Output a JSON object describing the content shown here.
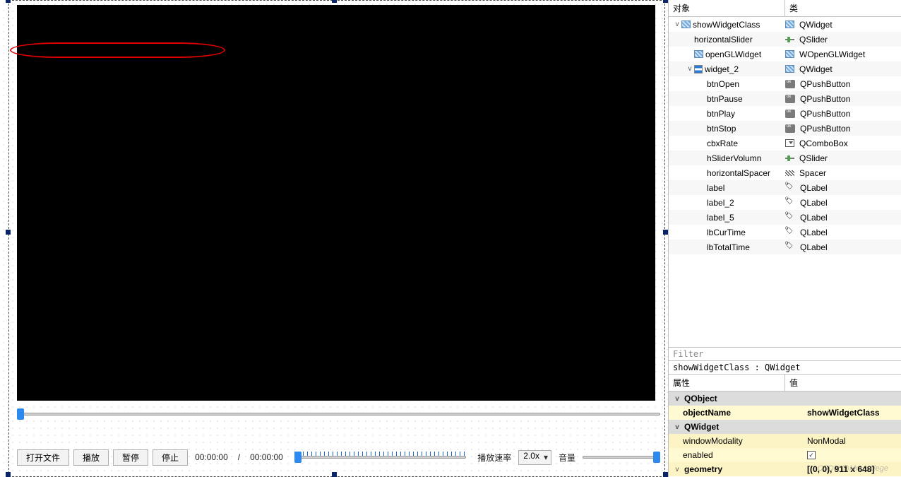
{
  "buttons": {
    "open": "打开文件",
    "play": "播放",
    "pause": "暂停",
    "stop": "停止"
  },
  "time": {
    "cur": "00:00:00",
    "sep": "/",
    "total": "00:00:00"
  },
  "labels": {
    "rate": "播放速率",
    "volume": "音量"
  },
  "combo": {
    "rate_value": "2.0x"
  },
  "inspector": {
    "col_object": "对象",
    "col_class": "类",
    "rows": [
      {
        "depth": 0,
        "expand": "v",
        "obj": "showWidgetClass",
        "icon": "widget",
        "cls": "QWidget",
        "cicon": "widget"
      },
      {
        "depth": 1,
        "expand": "",
        "obj": "horizontalSlider",
        "icon": "",
        "cls": "QSlider",
        "cicon": "slider"
      },
      {
        "depth": 1,
        "expand": "",
        "obj": "openGLWidget",
        "icon": "widget",
        "cls": "WOpenGLWidget",
        "cicon": "widget"
      },
      {
        "depth": 1,
        "expand": "v",
        "obj": "widget_2",
        "icon": "vbox",
        "cls": "QWidget",
        "cicon": "widget"
      },
      {
        "depth": 2,
        "expand": "",
        "obj": "btnOpen",
        "icon": "",
        "cls": "QPushButton",
        "cicon": "btn"
      },
      {
        "depth": 2,
        "expand": "",
        "obj": "btnPause",
        "icon": "",
        "cls": "QPushButton",
        "cicon": "btn"
      },
      {
        "depth": 2,
        "expand": "",
        "obj": "btnPlay",
        "icon": "",
        "cls": "QPushButton",
        "cicon": "btn"
      },
      {
        "depth": 2,
        "expand": "",
        "obj": "btnStop",
        "icon": "",
        "cls": "QPushButton",
        "cicon": "btn"
      },
      {
        "depth": 2,
        "expand": "",
        "obj": "cbxRate",
        "icon": "",
        "cls": "QComboBox",
        "cicon": "combo"
      },
      {
        "depth": 2,
        "expand": "",
        "obj": "hSliderVolumn",
        "icon": "",
        "cls": "QSlider",
        "cicon": "slider"
      },
      {
        "depth": 2,
        "expand": "",
        "obj": "horizontalSpacer",
        "icon": "",
        "cls": "Spacer",
        "cicon": "spacer"
      },
      {
        "depth": 2,
        "expand": "",
        "obj": "label",
        "icon": "",
        "cls": "QLabel",
        "cicon": "label"
      },
      {
        "depth": 2,
        "expand": "",
        "obj": "label_2",
        "icon": "",
        "cls": "QLabel",
        "cicon": "label"
      },
      {
        "depth": 2,
        "expand": "",
        "obj": "label_5",
        "icon": "",
        "cls": "QLabel",
        "cicon": "label"
      },
      {
        "depth": 2,
        "expand": "",
        "obj": "lbCurTime",
        "icon": "",
        "cls": "QLabel",
        "cicon": "label"
      },
      {
        "depth": 2,
        "expand": "",
        "obj": "lbTotalTime",
        "icon": "",
        "cls": "QLabel",
        "cicon": "label"
      }
    ]
  },
  "props": {
    "filter_placeholder": "Filter",
    "class_line": "showWidgetClass : QWidget",
    "col_prop": "属性",
    "col_val": "值",
    "rows": [
      {
        "type": "group",
        "name": "QObject"
      },
      {
        "type": "prop",
        "name": "objectName",
        "val": "showWidgetClass",
        "bold": true
      },
      {
        "type": "group",
        "name": "QWidget"
      },
      {
        "type": "prop",
        "name": "windowModality",
        "val": "NonModal"
      },
      {
        "type": "prop",
        "name": "enabled",
        "val_check": true
      },
      {
        "type": "prop",
        "name": "geometry",
        "val": "[(0, 0), 911 x 648]",
        "bold": true,
        "expand": "v"
      }
    ]
  },
  "watermark": "CSDN @Mr_codege"
}
